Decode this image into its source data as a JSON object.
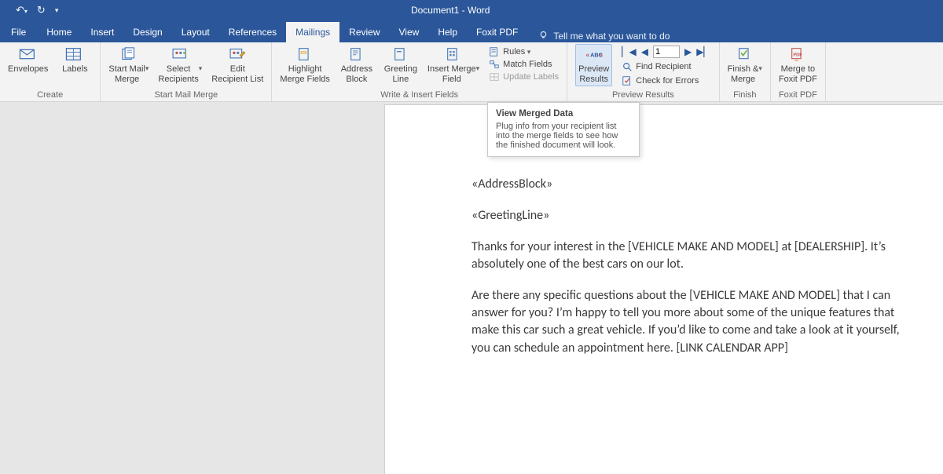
{
  "title": "Document1  -  Word",
  "tabs": {
    "file": "File",
    "home": "Home",
    "insert": "Insert",
    "design": "Design",
    "layout": "Layout",
    "references": "References",
    "mailings": "Mailings",
    "review": "Review",
    "view": "View",
    "help": "Help",
    "foxit": "Foxit PDF",
    "tellme": "Tell me what you want to do"
  },
  "ribbon": {
    "create": {
      "envelopes": "Envelopes",
      "labels": "Labels",
      "group": "Create"
    },
    "start": {
      "start_mail": "Start Mail\nMerge",
      "select_recipients": "Select\nRecipients",
      "edit_recipients": "Edit\nRecipient List",
      "group": "Start Mail Merge"
    },
    "write": {
      "highlight": "Highlight\nMerge Fields",
      "address": "Address\nBlock",
      "greeting": "Greeting\nLine",
      "insert_merge": "Insert Merge\nField",
      "rules": "Rules",
      "match": "Match Fields",
      "update": "Update Labels",
      "group": "Write & Insert Fields"
    },
    "preview": {
      "preview_results": "Preview\nResults",
      "find_recipient": "Find Recipient",
      "check_errors": "Check for Errors",
      "record_value": "1",
      "group": "Preview Results"
    },
    "finish": {
      "finish_merge": "Finish &\nMerge",
      "group": "Finish"
    },
    "foxit": {
      "merge_to": "Merge to\nFoxit PDF",
      "group": "Foxit PDF"
    }
  },
  "tooltip": {
    "title": "View Merged Data",
    "body": "Plug info from your recipient list into the merge fields to see how the finished document will look."
  },
  "document": {
    "address_block": "«AddressBlock»",
    "greeting_line": "«GreetingLine»",
    "p1": "Thanks for your interest in the [VEHICLE MAKE AND MODEL] at [DEALERSHIP]. It’s absolutely one of the best cars on our lot.",
    "p2": "Are there any specific questions about the [VEHICLE MAKE AND MODEL] that I can answer for you? I’m happy to tell you more about some of the unique features that make this car such a great vehicle. If you’d like to come and take a look at it yourself, you can schedule an appointment here. [LINK CALENDAR APP]"
  }
}
